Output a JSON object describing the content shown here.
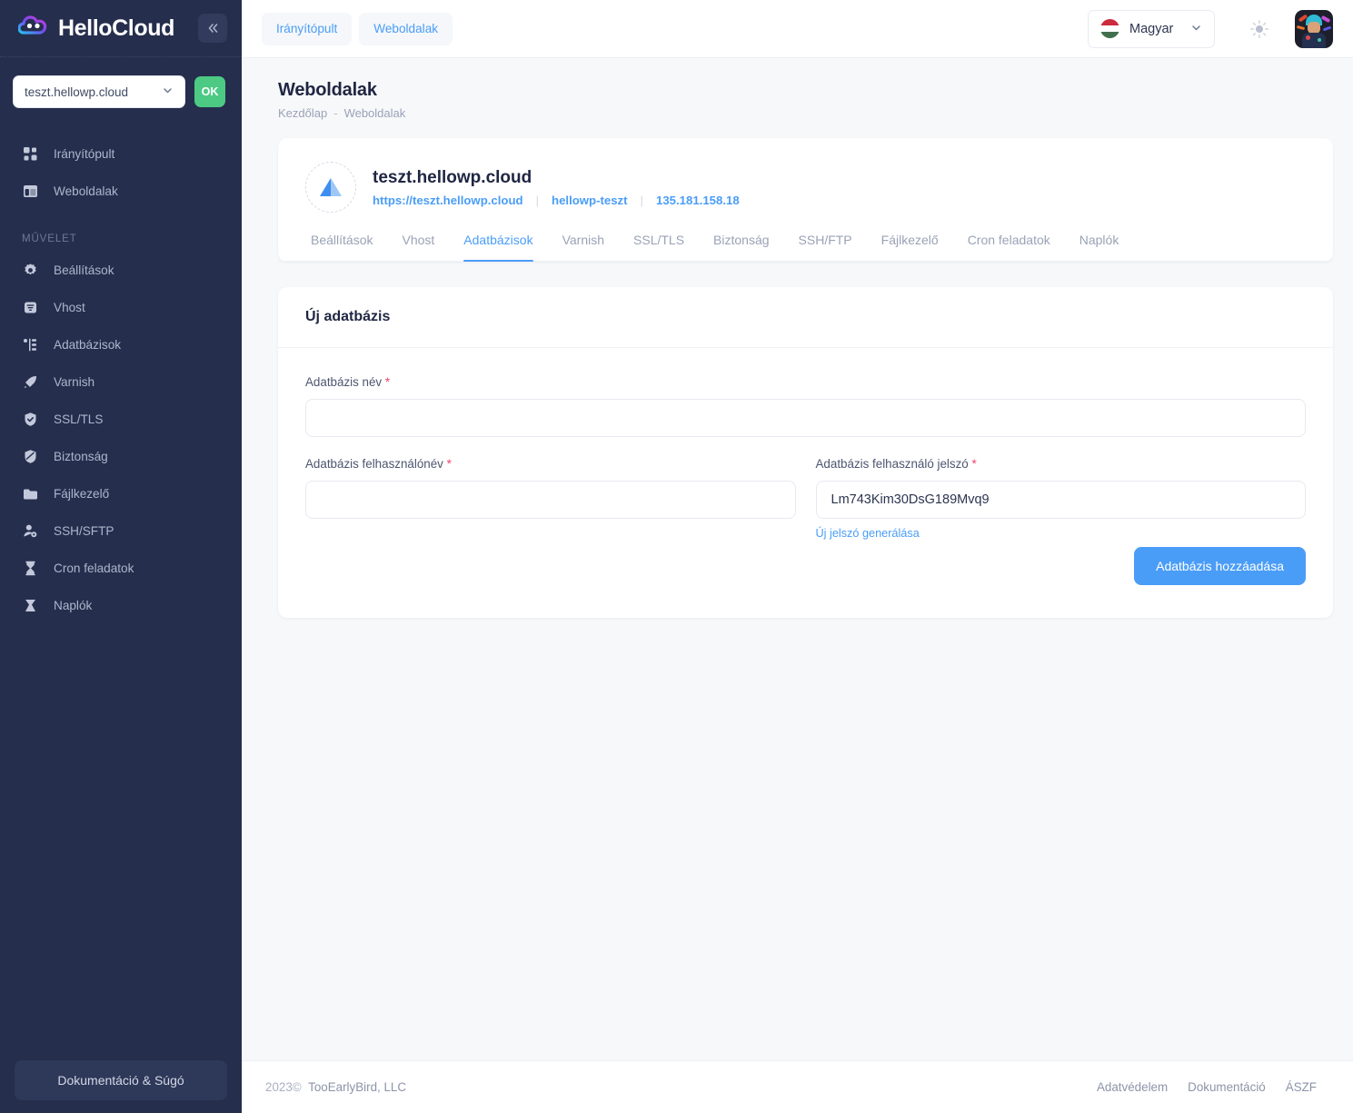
{
  "sidebar": {
    "brand": "HelloCloud",
    "collapse_icon": "chevron-left-double-icon",
    "site_selector": {
      "value": "teszt.hellowp.cloud",
      "chevron": "chevron-down-icon"
    },
    "ok_button": "OK",
    "nav_top": [
      {
        "label": "Irányítópult",
        "icon": "dashboard-grid-icon"
      },
      {
        "label": "Weboldalak",
        "icon": "layout-window-icon"
      }
    ],
    "section_label": "MŰVELET",
    "nav_actions": [
      {
        "label": "Beállítások",
        "icon": "gear-icon"
      },
      {
        "label": "Vhost",
        "icon": "server-filter-icon"
      },
      {
        "label": "Adatbázisok",
        "icon": "database-tree-icon"
      },
      {
        "label": "Varnish",
        "icon": "rocket-icon"
      },
      {
        "label": "SSL/TLS",
        "icon": "shield-check-icon"
      },
      {
        "label": "Biztonság",
        "icon": "shield-icon"
      },
      {
        "label": "Fájlkezelő",
        "icon": "folder-icon"
      },
      {
        "label": "SSH/SFTP",
        "icon": "user-key-icon"
      },
      {
        "label": "Cron feladatok",
        "icon": "hourglass-icon"
      },
      {
        "label": "Naplók",
        "icon": "logs-icon"
      }
    ],
    "doc_button": "Dokumentáció & Súgó"
  },
  "topbar": {
    "tabs": [
      {
        "label": "Irányítópult"
      },
      {
        "label": "Weboldalak"
      }
    ],
    "language": {
      "value": "Magyar",
      "flag": "hungary-flag-icon",
      "chevron": "chevron-down-icon"
    },
    "theme_toggle_icon": "sun-icon",
    "avatar_icon": "user-avatar"
  },
  "page": {
    "title": "Weboldalak",
    "breadcrumb": {
      "home": "Kezdőlap",
      "separator": "-",
      "current": "Weboldalak"
    }
  },
  "site": {
    "icon": "triangle-mountain-icon",
    "name": "teszt.hellowp.cloud",
    "url": "https://teszt.hellowp.cloud",
    "handle": "hellowp-teszt",
    "ip": "135.181.158.18",
    "divider": "|"
  },
  "site_tabs": [
    {
      "label": "Beállítások",
      "active": false
    },
    {
      "label": "Vhost",
      "active": false
    },
    {
      "label": "Adatbázisok",
      "active": true
    },
    {
      "label": "Varnish",
      "active": false
    },
    {
      "label": "SSL/TLS",
      "active": false
    },
    {
      "label": "Biztonság",
      "active": false
    },
    {
      "label": "SSH/FTP",
      "active": false
    },
    {
      "label": "Fájlkezelő",
      "active": false
    },
    {
      "label": "Cron feladatok",
      "active": false
    },
    {
      "label": "Naplók",
      "active": false
    }
  ],
  "form": {
    "heading": "Új adatbázis",
    "db_name": {
      "label": "Adatbázis név",
      "required": "*",
      "value": "",
      "placeholder": ""
    },
    "db_user": {
      "label": "Adatbázis felhasználónév",
      "required": "*",
      "value": "",
      "placeholder": ""
    },
    "db_pass": {
      "label": "Adatbázis felhasználó jelszó",
      "required": "*",
      "value": "Lm743Kim30DsG189Mvq9",
      "placeholder": ""
    },
    "generate_link": "Új jelszó generálása",
    "submit": "Adatbázis hozzáadása"
  },
  "footer": {
    "year": "2023",
    "copyright_symbol": "©",
    "company": "TooEarlyBird, LLC",
    "links": [
      {
        "label": "Adatvédelem"
      },
      {
        "label": "Dokumentáció"
      },
      {
        "label": "ÁSZF"
      }
    ]
  },
  "colors": {
    "sidebar_bg": "#252e4d",
    "accent_blue": "#4a9df7",
    "ok_green": "#4cca84",
    "required_red": "#f0436b",
    "page_bg": "#f7f8fa"
  }
}
